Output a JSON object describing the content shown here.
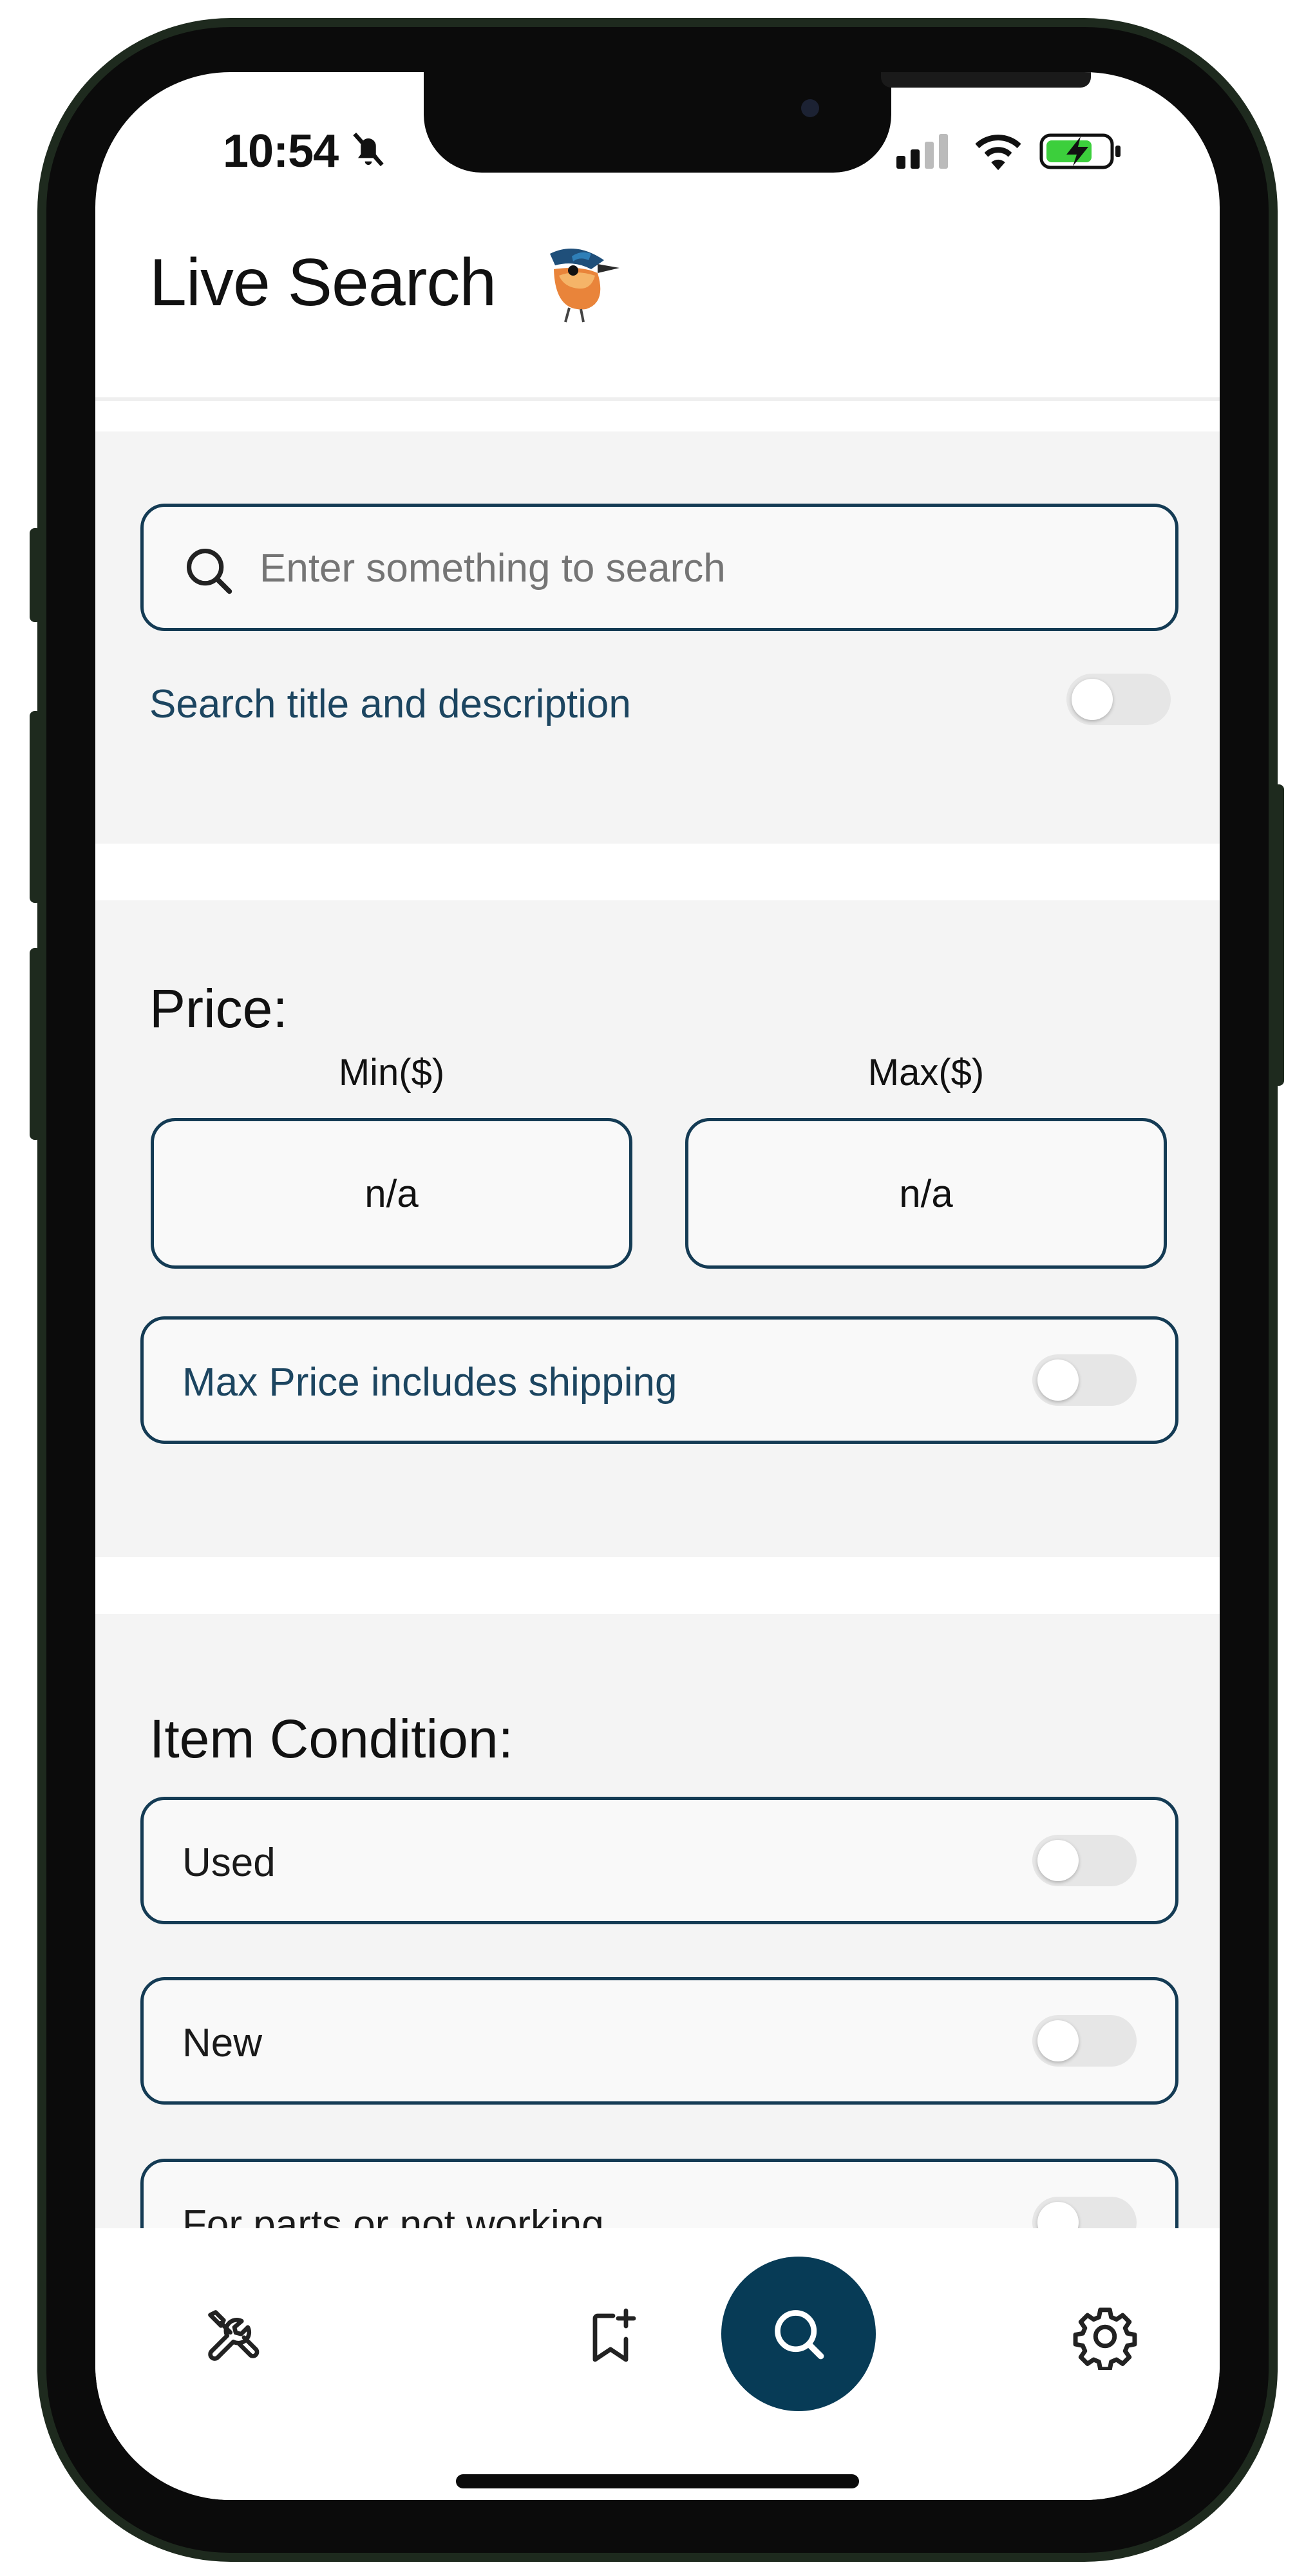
{
  "status_bar": {
    "time": "10:54"
  },
  "header": {
    "title": "Live Search"
  },
  "search": {
    "placeholder": "Enter something to search",
    "value": "",
    "toggle_label": "Search title and description",
    "toggle_on": false
  },
  "price": {
    "heading": "Price:",
    "min_label": "Min($)",
    "max_label": "Max($)",
    "min_value": "n/a",
    "max_value": "n/a",
    "shipping_label": "Max Price includes shipping",
    "shipping_on": false
  },
  "condition": {
    "heading": "Item Condition:",
    "items": [
      {
        "label": "Used",
        "on": false
      },
      {
        "label": "New",
        "on": false
      },
      {
        "label": "For parts or not working",
        "on": false
      }
    ]
  },
  "nav": {
    "items": [
      "tools-icon",
      "bookmark-add-icon",
      "search-icon",
      "settings-icon"
    ],
    "active": "search-icon"
  },
  "colors": {
    "accent": "#073b56",
    "border": "#143b54",
    "label_blue": "#1c4560",
    "section_bg": "#f4f4f4"
  }
}
